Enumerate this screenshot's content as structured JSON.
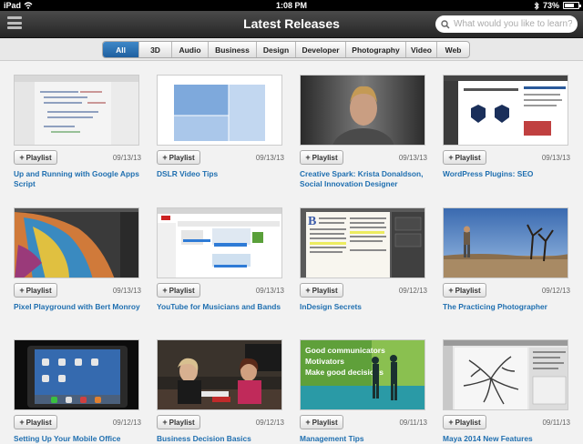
{
  "status": {
    "device": "iPad",
    "time": "1:08 PM",
    "battery": "73%",
    "battery_level": 0.73
  },
  "nav": {
    "title": "Latest Releases",
    "search_placeholder": "What would you like to learn?"
  },
  "filters": [
    {
      "label": "All",
      "active": true
    },
    {
      "label": "3D",
      "active": false
    },
    {
      "label": "Audio",
      "active": false
    },
    {
      "label": "Business",
      "active": false
    },
    {
      "label": "Design",
      "active": false
    },
    {
      "label": "Developer",
      "active": false
    },
    {
      "label": "Photography",
      "active": false
    },
    {
      "label": "Video",
      "active": false
    },
    {
      "label": "Web",
      "active": false
    }
  ],
  "playlist_label": "Playlist",
  "courses": [
    {
      "title": "Up and Running with Google Apps Script",
      "date": "09/13/13"
    },
    {
      "title": "DSLR Video Tips",
      "date": "09/13/13"
    },
    {
      "title": "Creative Spark: Krista Donaldson, Social Innovation Designer",
      "date": "09/13/13"
    },
    {
      "title": "WordPress Plugins: SEO",
      "date": "09/13/13"
    },
    {
      "title": "Pixel Playground with Bert Monroy",
      "date": "09/13/13"
    },
    {
      "title": "YouTube for Musicians and Bands",
      "date": "09/13/13"
    },
    {
      "title": "InDesign Secrets",
      "date": "09/12/13"
    },
    {
      "title": "The Practicing Photographer",
      "date": "09/12/13"
    },
    {
      "title": "Setting Up Your Mobile Office",
      "date": "09/12/13"
    },
    {
      "title": "Business Decision Basics",
      "date": "09/12/13"
    },
    {
      "title": "Management Tips",
      "date": "09/11/13"
    },
    {
      "title": "Maya 2014 New Features",
      "date": "09/11/13"
    }
  ],
  "thumb3": {
    "lines": [
      "Good communicators",
      "Motivators",
      "Make good decisions"
    ]
  }
}
